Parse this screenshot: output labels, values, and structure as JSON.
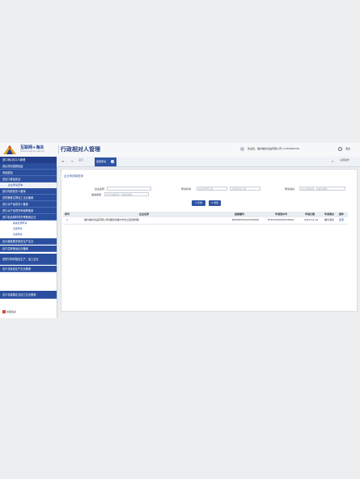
{
  "header": {
    "logo_title": "互联网+海关",
    "logo_subtitle": "internet plus all customs",
    "app_title": "行政相对人管理",
    "welcome": "欢迎您，福州福井食品有限公司 17765586756",
    "exit": "退出"
  },
  "sidebar": {
    "section": "进口商/出口人管理",
    "items": [
      {
        "label": "进出境动植物检疫",
        "level": 1
      },
      {
        "label": "商品检验",
        "level": 1
      },
      {
        "label": "进出口食品安全",
        "level": 1
      },
      {
        "label": "企业申请查询",
        "level": 2
      },
      {
        "label": "进口肉类收货人备案",
        "level": 1
      },
      {
        "label": "进境粮食生物加工企业备案",
        "level": 1
      },
      {
        "label": "进口水产品收货人备案",
        "level": 1
      },
      {
        "label": "进口水产品境外养殖等备案",
        "level": 1
      },
      {
        "label": "进口乳品原料境外等备案企业",
        "level": 1
      },
      {
        "label": "备案变更申请",
        "level": 3
      },
      {
        "label": "变更申请",
        "level": 3
      },
      {
        "label": "注销申请",
        "level": 3
      },
      {
        "label": "出口蔬菜果冻相关生产企业",
        "level": 1
      },
      {
        "label": "出口生鲜食品企业备案",
        "level": 1
      },
      {
        "label": "进境中药材指定生产、加工企业",
        "level": 1
      },
      {
        "label": "出口化妆品生产企业备案",
        "level": 1
      },
      {
        "label": "出口包装箱企业加工企业备案",
        "level": 1
      }
    ]
  },
  "tabs": {
    "home": "首页",
    "active": "变更申请",
    "close_all": "关闭操作"
  },
  "panel": {
    "title": "企业申请单查询",
    "fields": {
      "company_name_label": "企业名称",
      "apply_time_label": "申请时间",
      "start_date_placeholder": "请选择开始日期",
      "end_date_placeholder": "请选择结束日期",
      "customs_label": "申请海关",
      "customs_placeholder": "请空(申请批准、填申请模板)",
      "type_label": "备案类型",
      "type_placeholder": "请空(申请批准、填申请模板)"
    },
    "buttons": {
      "query": "查询",
      "reset": "重置"
    }
  },
  "table": {
    "headers": [
      "序号",
      "企业名称",
      "备案编号",
      "申请流水号",
      "申请日期",
      "申请海关",
      "操作"
    ],
    "rows": [
      [
        "1",
        "福州福井食品有限公司(福建省福州市仓山区建新镇)",
        "B60ZZ5C0020190006",
        "EF420190000126406",
        "2019-12-10",
        "福州海关",
        "变更"
      ]
    ]
  },
  "footer": {
    "text": "中国海关"
  }
}
